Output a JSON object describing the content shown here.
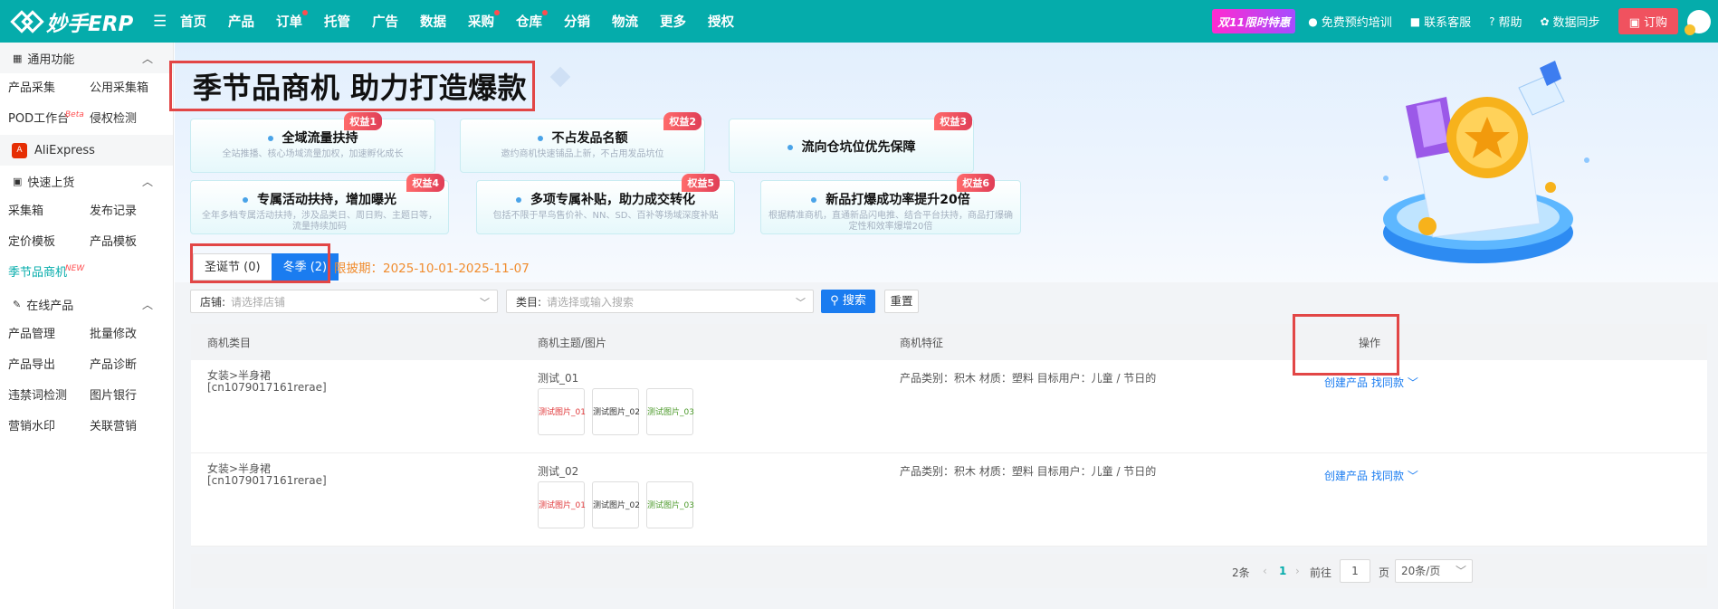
{
  "app": {
    "name": "妙手ERP"
  },
  "nav": [
    {
      "label": "首页",
      "dot": false
    },
    {
      "label": "产品",
      "dot": false
    },
    {
      "label": "订单",
      "dot": true
    },
    {
      "label": "托管",
      "dot": false
    },
    {
      "label": "广告",
      "dot": false
    },
    {
      "label": "数据",
      "dot": false
    },
    {
      "label": "采购",
      "dot": true
    },
    {
      "label": "仓库",
      "dot": true
    },
    {
      "label": "分销",
      "dot": false
    },
    {
      "label": "物流",
      "dot": false
    },
    {
      "label": "更多",
      "dot": false
    },
    {
      "label": "授权",
      "dot": false
    }
  ],
  "topright": {
    "promo": "双11限时特惠",
    "training": "免费预约培训",
    "service": "联系客服",
    "help": "帮助",
    "sync": "数据同步",
    "order": "订购"
  },
  "sidebar": {
    "general": {
      "title": "通用功能",
      "items": [
        "产品采集",
        "公用采集箱",
        "POD工作台",
        "侵权检测"
      ],
      "pod_badge": "Beta"
    },
    "aliexpress": "AliExpress",
    "quick": {
      "title": "快速上货",
      "items": [
        "采集箱",
        "发布记录",
        "定价模板",
        "产品模板",
        "季节品商机"
      ],
      "new_badge": "NEW"
    },
    "online": {
      "title": "在线产品",
      "items": [
        "产品管理",
        "批量修改",
        "产品导出",
        "产品诊断",
        "违禁词检测",
        "图片银行",
        "营销水印",
        "关联营销"
      ]
    }
  },
  "banner": {
    "title": "季节品商机 助力打造爆款",
    "cards": [
      {
        "title": "全域流量扶持",
        "desc": "全站推播、核心场域流量加权，加速孵化成长",
        "tag": "权益1"
      },
      {
        "title": "不占发品名额",
        "desc": "邀约商机快速铺品上新，不占用发品坑位",
        "tag": "权益2"
      },
      {
        "title": "流向仓坑位优先保障",
        "desc": "",
        "tag": "权益3"
      },
      {
        "title": "专属活动扶持，增加曝光",
        "desc": "全年多档专属活动扶持，涉及品类日、周日购、主题日等，流量持续加码",
        "tag": "权益4"
      },
      {
        "title": "多项专属补贴，助力成交转化",
        "desc": "包括不限于早鸟售价补、NN、SD、百补等场域深度补贴",
        "tag": "权益5"
      },
      {
        "title": "新品打爆成功率提升20倍",
        "desc": "根据精准商机，直通新品闪电推、结合平台扶持，商品打爆确定性和效率爆增20倍",
        "tag": "权益6"
      }
    ]
  },
  "tabs": [
    {
      "label": "圣诞节 (0)",
      "active": false
    },
    {
      "label": "冬季 (2)",
      "active": true
    }
  ],
  "deadline": "限披期：2025-10-01-2025-11-07",
  "filters": {
    "store_label": "店铺:",
    "store_placeholder": "请选择店铺",
    "category_label": "类目:",
    "category_placeholder": "请选择或输入搜索",
    "search": "搜索",
    "reset": "重置"
  },
  "table": {
    "headers": [
      "商机类目",
      "商机主题/图片",
      "商机特征",
      "操作"
    ],
    "rows": [
      {
        "category": "女装>半身裙",
        "code": "[cn1079017161rerae]",
        "topic": "测试_01",
        "images": [
          "测试图片_01",
          "测试图片_02",
          "测试图片_03"
        ],
        "features": "产品类别：积木  材质：塑料  目标用户：儿童 / 节日的",
        "create": "创建产品",
        "find": "找同款"
      },
      {
        "category": "女装>半身裙",
        "code": "[cn1079017161rerae]",
        "topic": "测试_02",
        "images": [
          "测试图片_01",
          "测试图片_02",
          "测试图片_03"
        ],
        "features": "产品类别：积木  材质：塑料  目标用户：儿童 / 节日的",
        "create": "创建产品",
        "find": "找同款"
      }
    ],
    "image_colors": [
      "#e0383a",
      "#333333",
      "#4c9a2a"
    ]
  },
  "pager": {
    "total": "2条",
    "page": "1",
    "goto": "前往",
    "input": "1",
    "unit": "页",
    "size": "20条/页"
  }
}
